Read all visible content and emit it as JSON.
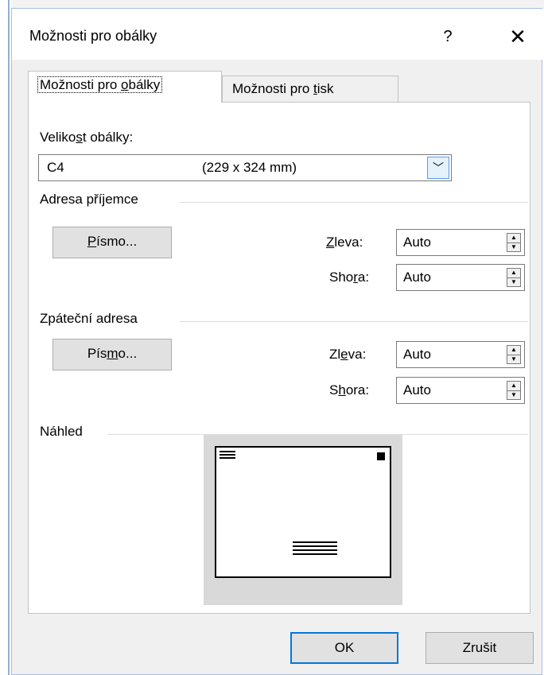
{
  "window": {
    "title": "Možnosti pro obálky",
    "help": "?",
    "close": "✕"
  },
  "tabs": [
    {
      "pre": "Možnosti pro ",
      "u": "o",
      "post": "bálky"
    },
    {
      "pre": "Možnosti pro ",
      "u": "t",
      "post": "isk"
    }
  ],
  "envelope_size": {
    "label_pre": "Veliko",
    "label_u": "s",
    "label_post": "t obálky:",
    "code": "C4",
    "dimensions": "(229 x 324 mm)"
  },
  "recipient": {
    "heading": "Adresa příjemce",
    "font_button": {
      "u": "P",
      "post": "ísmo..."
    },
    "left_label": {
      "u": "Z",
      "post": "leva:"
    },
    "left_value": "Auto",
    "top_label": {
      "pre": "Sho",
      "u": "r",
      "post": "a:"
    },
    "top_value": "Auto"
  },
  "return_address": {
    "heading": "Zpáteční adresa",
    "font_button": {
      "pre": "Pís",
      "u": "m",
      "post": "o..."
    },
    "left_label": {
      "pre": "Zl",
      "u": "e",
      "post": "va:"
    },
    "left_value": "Auto",
    "top_label": {
      "pre": "S",
      "u": "h",
      "post": "ora:"
    },
    "top_value": "Auto"
  },
  "preview": {
    "heading": "Náhled"
  },
  "buttons": {
    "ok": "OK",
    "cancel": "Zrušit"
  }
}
